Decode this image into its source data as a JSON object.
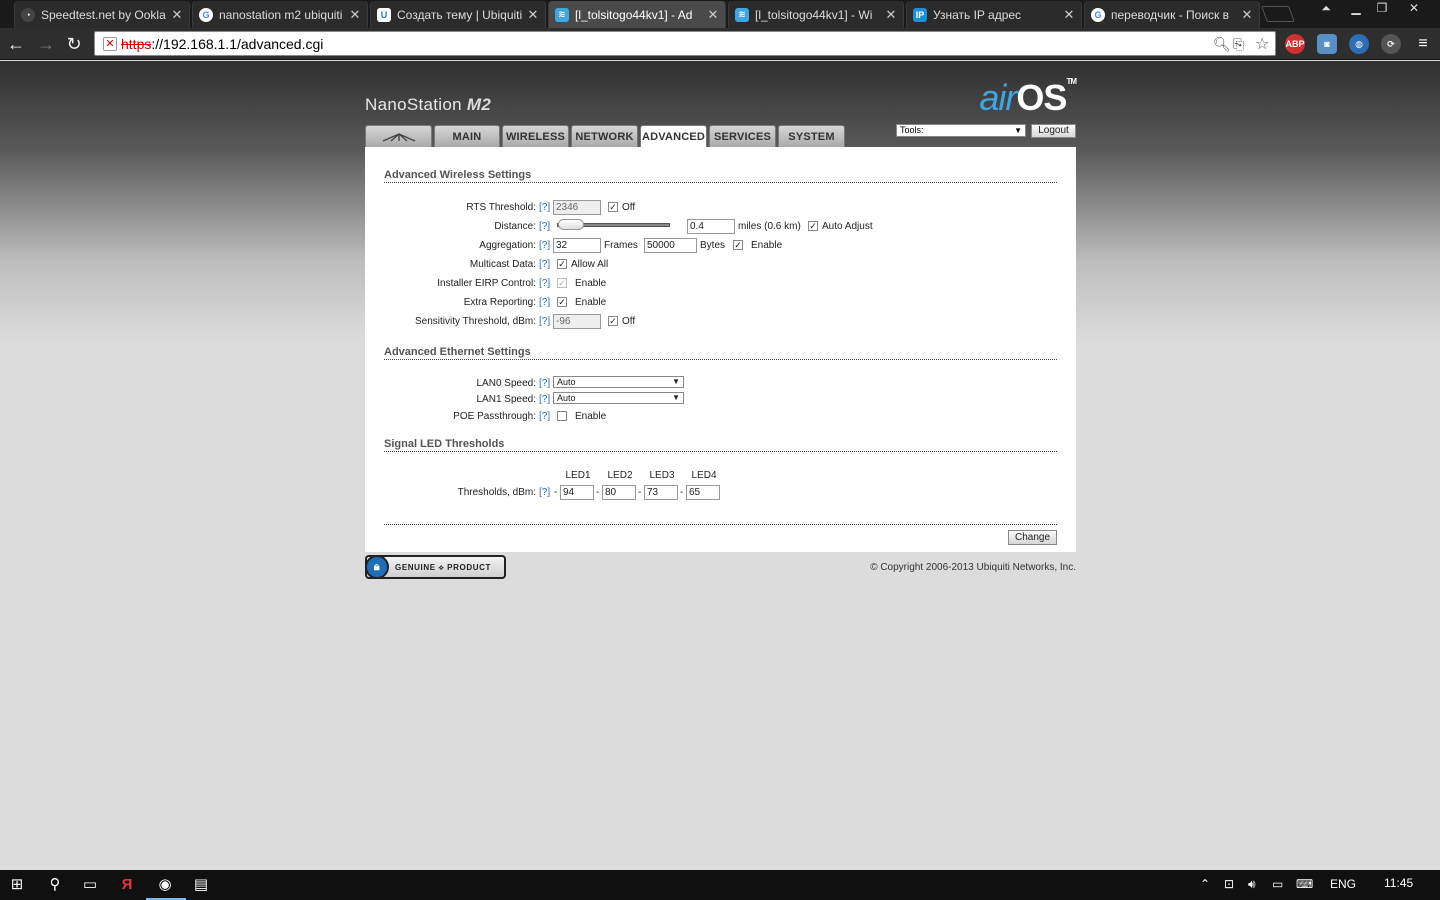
{
  "browser": {
    "tabs": [
      {
        "title": "Speedtest.net by Ookla",
        "icon": "speedtest-icon",
        "color": "#2b2b2b"
      },
      {
        "title": "nanostation m2 ubiquiti",
        "icon": "google-icon",
        "color": "#4285f4"
      },
      {
        "title": "Создать тему | Ubiquiti",
        "icon": "ubiquiti-icon",
        "color": "#2a6fb8"
      },
      {
        "title": "[l_tolsitogo44kv1] - Ad",
        "icon": "airos-tab-icon",
        "color": "#3ea7e3"
      },
      {
        "title": "[l_tolsitogo44kv1] - Wi",
        "icon": "airos-tab-icon",
        "color": "#3ea7e3"
      },
      {
        "title": "Узнать IP адрес",
        "icon": "ip-icon",
        "color": "#1e8fd6"
      },
      {
        "title": "переводчик - Поиск в",
        "icon": "google-icon",
        "color": "#4285f4"
      }
    ],
    "active_tab_index": 3,
    "url_scheme": "https",
    "url_rest": "://192.168.1.1/advanced.cgi",
    "extensions": {
      "abp": "ABP"
    }
  },
  "app": {
    "product_name": "NanoStation",
    "product_model": "M2",
    "logo_air": "air",
    "logo_os": "OS",
    "logo_tm": "TM",
    "tabs": [
      {
        "label": "",
        "width_key": "logo"
      },
      {
        "label": "MAIN"
      },
      {
        "label": "WIRELESS"
      },
      {
        "label": "NETWORK"
      },
      {
        "label": "ADVANCED"
      },
      {
        "label": "SERVICES"
      },
      {
        "label": "SYSTEM"
      }
    ],
    "active_tab": "ADVANCED",
    "tools_label": "Tools:",
    "logout_label": "Logout"
  },
  "wireless": {
    "heading": "Advanced Wireless Settings",
    "help": "[?]",
    "rts": {
      "label": "RTS Threshold:",
      "value": "2346",
      "off_label": "Off",
      "off_checked": true
    },
    "distance": {
      "label": "Distance:",
      "value": "0.4",
      "unit": "miles (0.6 km)",
      "auto_label": "Auto Adjust",
      "auto_checked": true,
      "slider_fraction": 0.0
    },
    "aggregation": {
      "label": "Aggregation:",
      "frames": "32",
      "frames_label": "Frames",
      "bytes": "50000",
      "bytes_label": "Bytes",
      "enable_label": "Enable",
      "enable_checked": true
    },
    "multicast": {
      "label": "Multicast Data:",
      "allow_label": "Allow All",
      "checked": true
    },
    "eirp": {
      "label": "Installer EIRP Control:",
      "enable_label": "Enable",
      "checked": true
    },
    "extra": {
      "label": "Extra Reporting:",
      "enable_label": "Enable",
      "checked": true
    },
    "sensitivity": {
      "label": "Sensitivity Threshold, dBm:",
      "value": "-96",
      "off_label": "Off",
      "off_checked": true
    }
  },
  "ethernet": {
    "heading": "Advanced Ethernet Settings",
    "lan0": {
      "label": "LAN0 Speed:",
      "value": "Auto"
    },
    "lan1": {
      "label": "LAN1 Speed:",
      "value": "Auto"
    },
    "poe": {
      "label": "POE Passthrough:",
      "enable_label": "Enable",
      "checked": false
    }
  },
  "led": {
    "heading": "Signal LED Thresholds",
    "label": "Thresholds, dBm:",
    "headers": [
      "LED1",
      "LED2",
      "LED3",
      "LED4"
    ],
    "dash": "-",
    "values": [
      "94",
      "80",
      "73",
      "65"
    ]
  },
  "change_label": "Change",
  "genuine_text": "GENUINE ⟡ PRODUCT",
  "copyright": "© Copyright 2006-2013 Ubiquiti Networks, Inc.",
  "taskbar": {
    "language": "ENG",
    "time": "11:45"
  }
}
